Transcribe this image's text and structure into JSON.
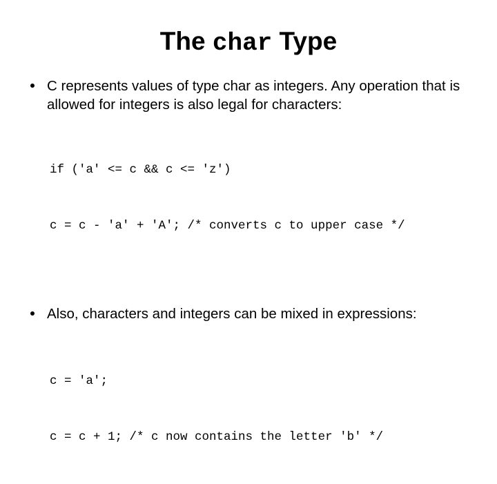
{
  "slide": {
    "title": {
      "prefix": "The ",
      "mono_word": "char",
      "suffix": " Type"
    },
    "background_color": "#ffffff",
    "text_color": "#000000",
    "bullets": [
      {
        "marker": "bullet-dot",
        "text": "C represents values of type char as integers. Any operation that is allowed for integers is also legal for characters:"
      },
      {
        "marker": "bullet-dot",
        "text": "Also, characters and integers can be mixed in expressions:"
      }
    ],
    "code_blocks": [
      {
        "lines": [
          "if ('a' <= c && c <= 'z')",
          "c = c - 'a' + 'A'; /* converts c to upper case */"
        ]
      },
      {
        "lines": [
          "c = 'a';",
          "c = c + 1; /* c now contains the letter 'b' */"
        ]
      }
    ]
  }
}
